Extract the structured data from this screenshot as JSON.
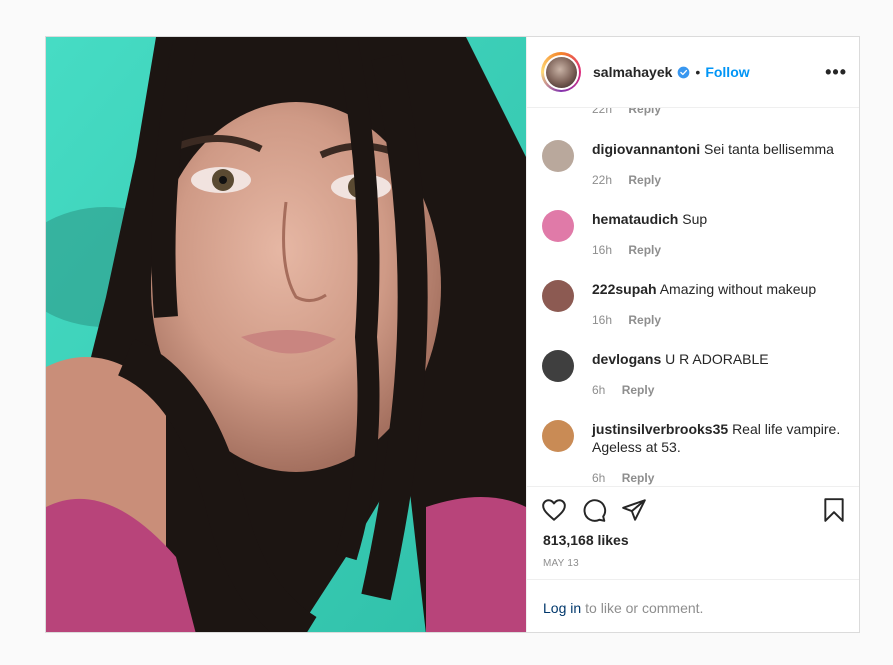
{
  "post": {
    "username": "salmahayek",
    "separator": "•",
    "follow_label": "Follow",
    "more_label": "•••"
  },
  "comments": [
    {
      "user": "",
      "text": "",
      "time": "22h",
      "reply": "Reply",
      "avatar_color": "#cccccc"
    },
    {
      "user": "digiovannantoni",
      "text": "Sei tanta bellisemma",
      "time": "22h",
      "reply": "Reply",
      "avatar_color": "#b9a89c"
    },
    {
      "user": "hemataudich",
      "text": "Sup",
      "time": "16h",
      "reply": "Reply",
      "avatar_color": "#e07aa8"
    },
    {
      "user": "222supah",
      "text": "Amazing without makeup",
      "time": "16h",
      "reply": "Reply",
      "avatar_color": "#8c5a52"
    },
    {
      "user": "devlogans",
      "text": "U R ADORABLE",
      "time": "6h",
      "reply": "Reply",
      "avatar_color": "#3f3f3f"
    },
    {
      "user": "justinsilverbrooks35",
      "text": "Real life vampire. Ageless at 53.",
      "time": "6h",
      "reply": "Reply",
      "avatar_color": "#c98b55"
    }
  ],
  "actions": {
    "likes": "813,168 likes",
    "date": "MAY 13",
    "login_link": "Log in",
    "login_rest": "to like or comment."
  },
  "icons": {
    "like": "heart-icon",
    "comment": "comment-icon",
    "share": "share-icon",
    "save": "bookmark-icon",
    "verified": "verified-badge-icon"
  },
  "colors": {
    "follow": "#0095f6",
    "verified": "#3897f0",
    "photo_background": "#3dd4be"
  }
}
